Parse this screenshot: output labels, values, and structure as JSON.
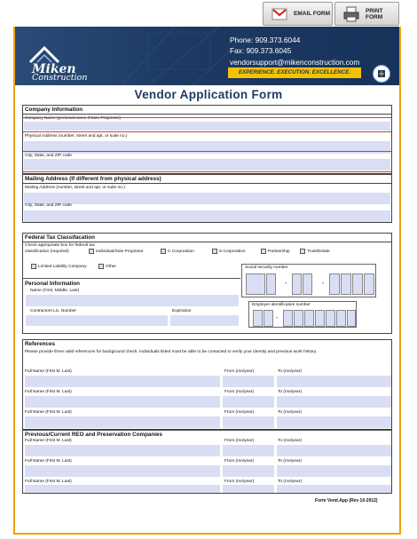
{
  "toolbar": {
    "email_label": "EMAIL FORM",
    "print_label": "PRINT FORM"
  },
  "company": {
    "logo_line1": "Miken",
    "logo_line2": "Construction",
    "phone": "Phone: 909.373.6044",
    "fax": "Fax: 909.373.6045",
    "email": "vendorsupport@mikenconstruction.com",
    "slogan": "EXPERIENCE. EXECUTION. EXCELLENCE."
  },
  "form_title": "Vendor Application Form",
  "company_info": {
    "heading": "Company Information",
    "name_label": "Company Name (personal name if Sole Proprietor)",
    "address_label": "Physical Address (number, street and apt. or suite no.)",
    "city_label": "City, State, and ZIP code"
  },
  "mailing": {
    "heading": "Mailing Address (If different from physical address)",
    "address_label": "Mailing Address (number, street and apt. or suite no.)",
    "city_label": "City, State, and ZIP code"
  },
  "tax": {
    "heading": "Federal Tax Classifacation",
    "check_line1": "Check appropriate box for federal tax",
    "check_line2": "classification (required):",
    "options": [
      "Individual/Sole Proprietor",
      "C Corporation",
      "S Corporation",
      "Partnership",
      "Trust/Estate",
      "Limited Liability Company",
      "Other"
    ],
    "ssn_label": "Social security number",
    "ein_label": "Employer identification number"
  },
  "personal": {
    "heading": "Personal Information",
    "name_label": "Name (First, Middle, Last)",
    "license_label": "Contractors Lic. Number",
    "expiration_label": "Expiration"
  },
  "references": {
    "heading": "References",
    "instructions": "Please provide three valid references for background check. Individuals listed must be able to be contacted to verify your identity and previous work history.",
    "name_label": "Full Name (First M. Last)",
    "from_label": "From (mo/year)",
    "to_label": "To (mo/year)"
  },
  "previous": {
    "heading": "Previous/Current REO and Preservation Companies",
    "name_label": "Full Name (First M. Last)",
    "from_label": "From (mo/year)",
    "to_label": "To (mo/year)"
  },
  "footer_text": "Form Vend.App (Rev 10-2012)",
  "colors": {
    "navy": "#1d3a63",
    "gold": "#f5c200",
    "field": "#d9def5",
    "border_orange": "#f2a000"
  }
}
